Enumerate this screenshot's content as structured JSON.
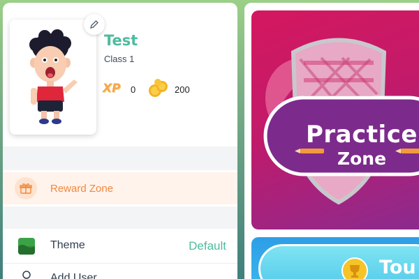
{
  "profile": {
    "name": "Test",
    "class_label": "Class 1",
    "xp_label": "XP",
    "xp_value": "0",
    "coins_value": "200"
  },
  "menu": {
    "reward_zone_label": "Reward Zone",
    "theme_label": "Theme",
    "theme_value": "Default",
    "add_user_label": "Add User"
  },
  "cards": {
    "practice_line1": "Practice",
    "practice_line2": "Zone",
    "tour_label": "Tou"
  },
  "colors": {
    "accent_teal": "#4dbb9f",
    "reward_orange": "#f0883e",
    "practice_pink": "#d4185f",
    "tour_blue": "#39b6ee"
  }
}
